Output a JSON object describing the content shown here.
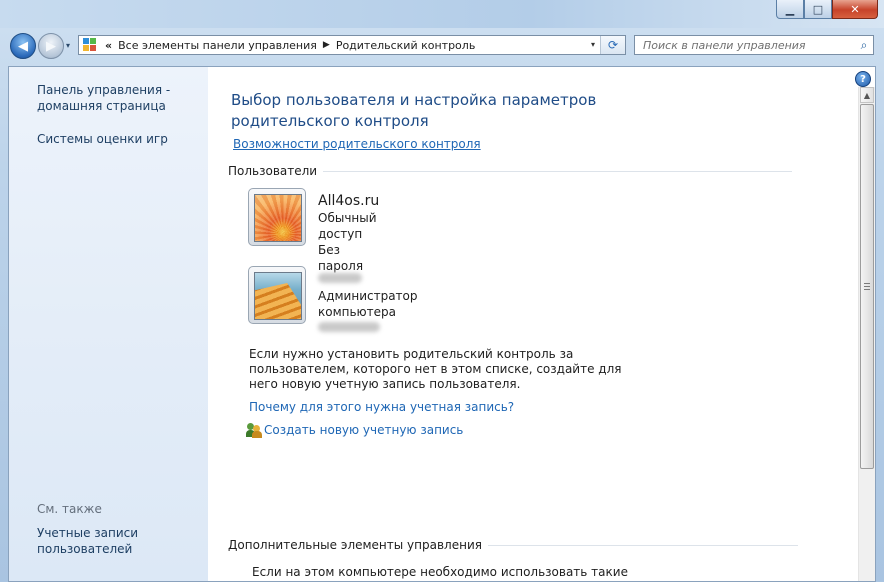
{
  "window": {
    "minimize": "▁",
    "maximize": "□",
    "close": "✕"
  },
  "nav": {
    "back_icon": "◀",
    "forward_icon": "▶",
    "dropdown_icon": "▾",
    "address": {
      "overflow": "«",
      "crumbs": [
        "Все элементы панели управления",
        "Родительский контроль"
      ],
      "separator": "▶",
      "refresh_icon": "⟳"
    },
    "search": {
      "placeholder": "Поиск в панели управления",
      "icon": "⌕"
    }
  },
  "sidebar": {
    "home": "Панель управления - домашняя страница",
    "games": "Системы оценки игр",
    "see_also": "См. также",
    "accounts": "Учетные записи пользователей"
  },
  "main": {
    "heading": "Выбор пользователя и настройка параметров родительского контроля",
    "features_link": "Возможности родительского контроля",
    "users_section": "Пользователи",
    "users": [
      {
        "name": "All4os.ru",
        "line1": "Обычный доступ",
        "line2": "Без пароля"
      },
      {
        "name": "",
        "line1": "Администратор компьютера",
        "line2": ""
      }
    ],
    "note": "Если нужно установить родительский контроль за пользователем, которого нет в этом списке, создайте для него новую учетную запись пользователя.",
    "why_link": "Почему для этого нужна учетная запись?",
    "create_link": "Создать новую учетную запись",
    "more_section": "Дополнительные элементы управления",
    "more_text": "Если на этом компьютере необходимо использовать такие"
  },
  "help_icon": "?",
  "colors": {
    "link": "#1f67b5",
    "heading": "#1f4c87",
    "sidebar_bg": "#e4edf8"
  }
}
